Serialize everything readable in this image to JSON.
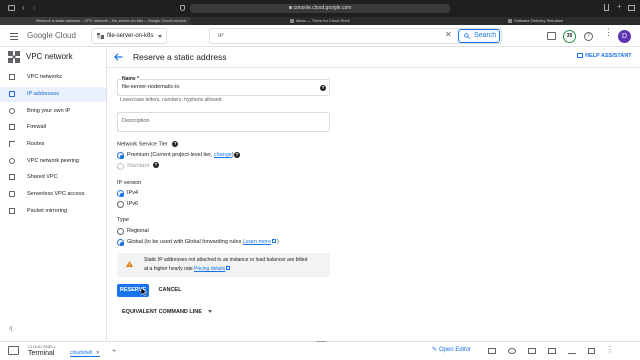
{
  "browser": {
    "url": "console.cloud.google.com",
    "tabs": [
      {
        "label": "Reserve a static address – VPC network – file-server-on-k8s – Google Cloud console",
        "active": true
      },
      {
        "label": "ideas — There for Cloud Shell",
        "active": false
      },
      {
        "label": "Software Delivery Simulator",
        "active": false
      }
    ]
  },
  "header": {
    "logo": "Google Cloud",
    "project": "file-server-on-k8s",
    "search_value": "IP",
    "search_button": "Search",
    "notification_count": "35",
    "avatar_initial": "D",
    "colors": {
      "accent": "#1a73e8",
      "avatar": "#5e35b1"
    }
  },
  "sidebar": {
    "title": "VPC network",
    "items": [
      {
        "label": "VPC networks",
        "icon": "network-icon"
      },
      {
        "label": "IP addresses",
        "icon": "ip-icon",
        "active": true
      },
      {
        "label": "Bring your own IP",
        "icon": "byoip-icon"
      },
      {
        "label": "Firewall",
        "icon": "firewall-icon"
      },
      {
        "label": "Routes",
        "icon": "routes-icon"
      },
      {
        "label": "VPC network peering",
        "icon": "peering-icon"
      },
      {
        "label": "Shared VPC",
        "icon": "shared-vpc-icon"
      },
      {
        "label": "Serverless VPC access",
        "icon": "serverless-icon"
      },
      {
        "label": "Packet mirroring",
        "icon": "mirroring-icon"
      }
    ],
    "collapse_label": "‹|"
  },
  "page": {
    "title": "Reserve a static address",
    "help_assistant": "HELP ASSISTANT",
    "name_label": "Name *",
    "name_value": "file-server-nodematic-io",
    "name_hint": "Lowercase letters, numbers, hyphens allowed",
    "description_placeholder": "Description",
    "tier_label": "Network Service Tier",
    "tier_premium": "Premium (Current project-level tier,",
    "tier_change": "change",
    "tier_premium_end": ")",
    "tier_standard": "Standard",
    "ipver_label": "IP version",
    "ipv4": "IPv4",
    "ipv6": "IPv6",
    "type_label": "Type",
    "type_regional": "Regional",
    "type_global": "Global (to be used with Global forwarding rules",
    "type_learn_more": "Learn more",
    "type_global_end": ")",
    "warning_text_1": "Static IP addresses not attached to an instance or load balancer are billed",
    "warning_text_2": "at a higher hourly rate",
    "pricing_link": "Pricing details",
    "reserve_button": "RESERVE",
    "cancel_button": "CANCEL",
    "equiv_cmd": "EQUIVALENT COMMAND LINE"
  },
  "terminal": {
    "cloud_shell": "CLOUD SHELL",
    "title": "Terminal",
    "tab": "cloudshell",
    "open_editor": "Open Editor"
  }
}
